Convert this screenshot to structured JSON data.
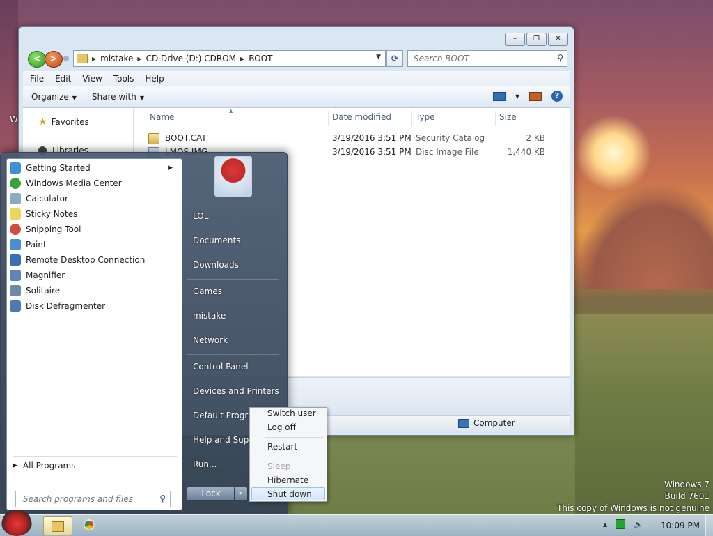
{
  "desktop": {
    "partial_label": "W",
    "genuine_notice": [
      "Windows 7",
      "Build 7601",
      "This copy of Windows is not genuine"
    ]
  },
  "explorer": {
    "window_controls": [
      "–",
      "❐",
      "✕"
    ],
    "nav": {
      "back": "<",
      "forward": ">"
    },
    "breadcrumb": [
      "mistake",
      "CD Drive (D:) CDROM",
      "BOOT"
    ],
    "search_placeholder": "Search BOOT",
    "menu": [
      "File",
      "Edit",
      "View",
      "Tools",
      "Help"
    ],
    "commands": {
      "organize": "Organize",
      "share_with": "Share with"
    },
    "help_label": "?",
    "navpane": {
      "favorites": "Favorites",
      "libraries": "Libraries"
    },
    "columns": {
      "name": "Name",
      "date": "Date modified",
      "type": "Type",
      "size": "Size"
    },
    "files": [
      {
        "name": "BOOT.CAT",
        "date": "3/19/2016 3:51 PM",
        "type": "Security Catalog",
        "size": "2 KB"
      },
      {
        "name": "LMOS.IMG",
        "date": "3/19/2016 3:51 PM",
        "type": "Disc Image File",
        "size": "1,440 KB"
      }
    ],
    "status_location": "Computer"
  },
  "start_menu": {
    "programs": [
      {
        "label": "Getting Started",
        "icon": "getting-started-icon",
        "color": "#3d8fd6",
        "has_submenu": true
      },
      {
        "label": "Windows Media Center",
        "icon": "media-center-icon",
        "color": "#3aa23a"
      },
      {
        "label": "Calculator",
        "icon": "calculator-icon",
        "color": "#8fa8c4"
      },
      {
        "label": "Sticky Notes",
        "icon": "sticky-notes-icon",
        "color": "#e8d75a"
      },
      {
        "label": "Snipping Tool",
        "icon": "snipping-tool-icon",
        "color": "#d24b3c"
      },
      {
        "label": "Paint",
        "icon": "paint-icon",
        "color": "#4c8fd0"
      },
      {
        "label": "Remote Desktop Connection",
        "icon": "remote-desktop-icon",
        "color": "#3a6fb5"
      },
      {
        "label": "Magnifier",
        "icon": "magnifier-icon",
        "color": "#5a86b8"
      },
      {
        "label": "Solitaire",
        "icon": "solitaire-icon",
        "color": "#6d8aa8"
      },
      {
        "label": "Disk Defragmenter",
        "icon": "disk-defrag-icon",
        "color": "#4d79b4"
      }
    ],
    "all_programs": "All Programs",
    "search_placeholder": "Search programs and files",
    "right_items": [
      "LOL",
      "Documents",
      "Downloads",
      "Games",
      "mistake",
      "Network",
      "Control Panel",
      "Devices and Printers",
      "Default Programs",
      "Help and Support",
      "Run..."
    ],
    "lock_label": "Lock",
    "power_arrow": "▸"
  },
  "power_submenu": {
    "items": [
      "Switch user",
      "Log off",
      "Restart",
      "Sleep",
      "Hibernate",
      "Shut down"
    ],
    "disabled": [
      "Sleep"
    ],
    "highlighted": "Shut down"
  },
  "taskbar": {
    "clock": "10:09 PM"
  }
}
